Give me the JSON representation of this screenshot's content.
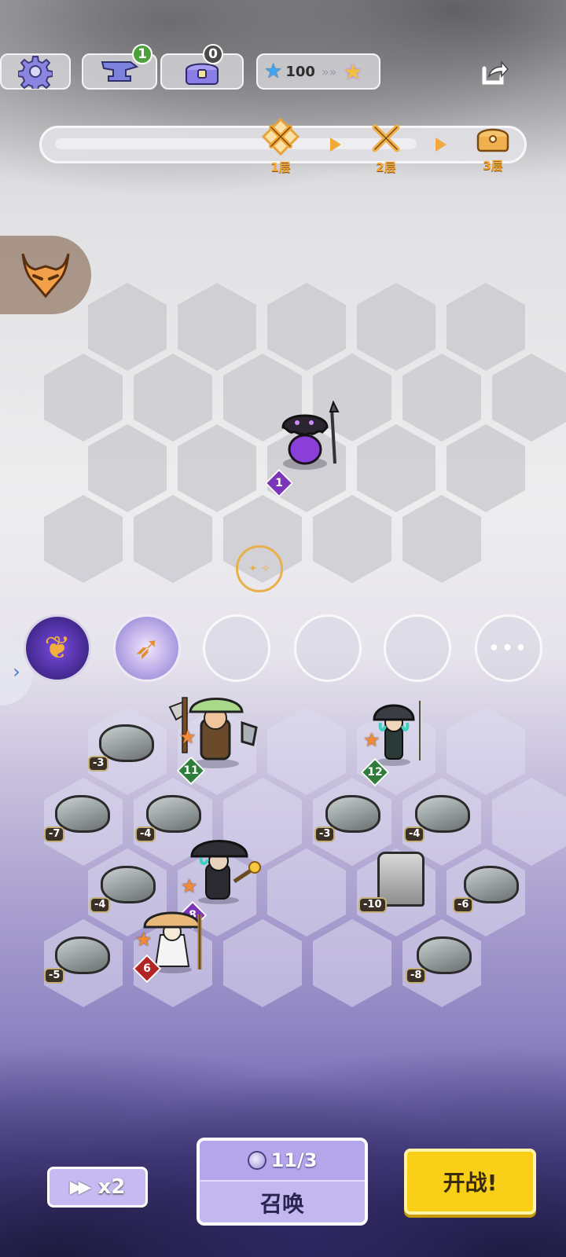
{
  "top_bar": {
    "settings_icon": "gear-icon",
    "anvil_icon": "anvil-icon",
    "anvil_count": "1",
    "chest_icon": "treasure-chest-icon",
    "chest_count": "0",
    "star_value": "100",
    "share_icon": "share-icon"
  },
  "progress": {
    "floors": [
      {
        "label": "1层",
        "icon": "crossed-swords-icon",
        "current": true
      },
      {
        "label": "2层",
        "icon": "crossed-swords-icon",
        "current": false
      },
      {
        "label": "3层",
        "icon": "treasure-chest-icon",
        "current": false
      }
    ]
  },
  "boss_icon": "demon-mask-icon",
  "enemy": {
    "name": "octopus-spearman",
    "level": "1"
  },
  "skill_slots": [
    "wing-skill-icon",
    "bow-skill-icon",
    "",
    "",
    ""
  ],
  "more_label": "•••",
  "side_tab_icon": "chevron-right-icon",
  "rocks": [
    "-3",
    "-7",
    "-4",
    "-3",
    "-4",
    "-4",
    "-6",
    "-5",
    "-8",
    "-10"
  ],
  "units": [
    {
      "name": "mushroom-warrior",
      "level": "11",
      "stars": 1
    },
    {
      "name": "mushroom-mage-girl",
      "level": "12",
      "stars": 1
    },
    {
      "name": "mushroom-wizard",
      "level": "8",
      "stars": 1
    },
    {
      "name": "mushroom-priest",
      "level": "6",
      "stars": 1
    }
  ],
  "bottom": {
    "speed_label": "x2",
    "summon_count": "11/3",
    "summon_label": "召唤",
    "fight_label": "开战!"
  },
  "colors": {
    "accent_orange": "#f0a93a",
    "fight_yellow": "#f9cf18",
    "summon_purple": "#c4b7ef",
    "level_green": "#2e7d3a",
    "level_red": "#b22323",
    "level_purple": "#7b35b8"
  }
}
